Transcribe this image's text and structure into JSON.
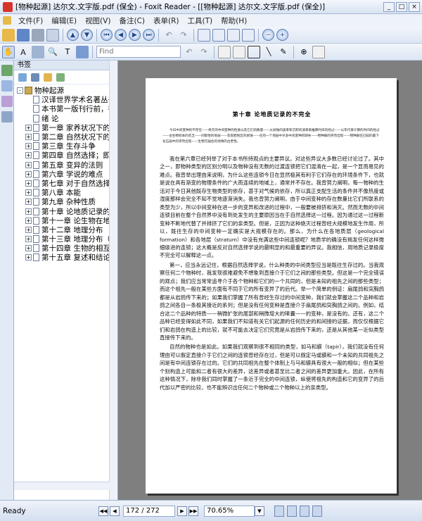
{
  "window": {
    "title": "[物种起源] 达尔文.文字版.pdf (保全) - Foxit Reader - [[物种起源] 达尔文.文字版.pdf (保全)]"
  },
  "menu": {
    "items": [
      "文件(F)",
      "编辑(E)",
      "视图(V)",
      "备注(C)",
      "表单(R)",
      "工具(T)",
      "帮助(H)"
    ]
  },
  "find": {
    "placeholder": "Find"
  },
  "bookmark_panel": {
    "title": "书签",
    "items": [
      {
        "label": "物种起源",
        "level": 0,
        "expander": "-"
      },
      {
        "label": "汉译世界学术名著丛书",
        "level": 1,
        "expander": ""
      },
      {
        "label": "本书第一版刊行前，有关",
        "level": 1,
        "expander": ""
      },
      {
        "label": "绪 论",
        "level": 1,
        "expander": ""
      },
      {
        "label": "第一章 家养状况下的变异",
        "level": 1,
        "expander": "+"
      },
      {
        "label": "第二章 自然状况下的变异",
        "level": 1,
        "expander": "+"
      },
      {
        "label": "第三章 生存斗争",
        "level": 1,
        "expander": "+"
      },
      {
        "label": "第四章 自然选择；即最适",
        "level": 1,
        "expander": "+"
      },
      {
        "label": "第五章 变异的法则",
        "level": 1,
        "expander": "+"
      },
      {
        "label": "第六章 学说的难点",
        "level": 1,
        "expander": "+"
      },
      {
        "label": "第七章 对于自然选择学说",
        "level": 1,
        "expander": "+"
      },
      {
        "label": "第八章 本能",
        "level": 1,
        "expander": "+"
      },
      {
        "label": "第九章 杂种性质",
        "level": 1,
        "expander": "+"
      },
      {
        "label": "第十章 论地质记录的不完",
        "level": 1,
        "expander": "+"
      },
      {
        "label": "第十一章 论生物在地质",
        "level": 1,
        "expander": "+"
      },
      {
        "label": "第十二章 地理分布",
        "level": 1,
        "expander": "+"
      },
      {
        "label": "第十三章 地理分布（续）",
        "level": 1,
        "expander": "+"
      },
      {
        "label": "第十四章 生物的相互亲缘",
        "level": 1,
        "expander": "+"
      },
      {
        "label": "第十五章 复述和结论",
        "level": 1,
        "expander": "+"
      }
    ]
  },
  "document": {
    "chapter_title": "第十章 论地质记录的不完全",
    "epigraph": "今日中间变种的不存在——绝灭的中间变种的性质以及它们的数量——从剥蚀的速率和沉积的速率来推算时间的经过——以年代来计算的时间的经过——古生物标本的贫乏——间歇性的地层——花岗岩地区的剥蚀——任何一个地层中许多中间变种的缺失——物种群的突然出现——物种群在已知的最下化石层中的突然出现——生物可居住的地球的古老性。",
    "paragraphs": [
      "我在第六章已经列举了对于本书所持观点的主要异议。对这些异议大多数已经讨论过了。其中之一，即物种类型的区别分明以及物种没有无数的过渡连锁把它们混淆在一起，是一个显而易见的难点。我曾举出理由来说明，为什么这些连锁今日在显然极其有利于它们存在的环境条件下，也就是说在具有渐变的物理条件的广大而连续的地域上，通常并不存在。我曾努力阐明，每一物种的生活对于今日其他既存生物类型的依存，甚于对气候的依存，所以真正支配生活的条件并不像热度或湿度那样会完全不知不觉地逐渐消失。我也曾努力阐明，由于中间变种的存在数量比它们所联系的类型为少，所以中间变种在进一步的变异和改进的过程中，一般要被排挤和消灭。然而无数的中间连锁目前在整个自然界中没有到处发生的主要原因当在于自然选择这一过程。因为通过这一过程新变种不断地代替了并排挤了它们的亲类型。但是，正因为这种绝灭过程曾经大规模地发生作用，所以，既往生存的中间变种一定确实是大规模存在的。那么，为什么在各地质层（geological formation）和各地层（stratum）中没有充满这些中间连锁呢？地质学的确没有揭发任何这样微细级进的连锁；这大概是反对自然选择学说的最明显的和最重要的异议。我相信，用地质记录极度不完全可以解释这一点。",
      "第一，应当永远记住，根据自然选择学说，什么种类的中间类型应当是既往生存过的。当我观察任何二个物种时，我发现很难避免不想象到直接介于它们之间的那些类型。但这是一个完全错误的观点；我们应当常常追寻介于各个物种和它们的一个共同的，但是未知的祖先之间的那些类型；而这个祖先一般在某些方面有不同于它的所有变异了的后代。举一个简单的例证：扇尾鸽和突胸鸽都是从岩鸽传下来的；如果我们掌握了所有曾经生存过的中间变种，我们就会掌握这二个品种和岩鸽之间各自一条极其接近的系列；但是没有任何变种是直接介于扇尾鸽和突胸鸽之间的。例如，结合这二个品种的特质——稍微扩张的尾部和稍微增大的嗉囊——的变种，是没有的。还有，这二个品种已经变得如此不同，如果我们不知道有关它们起源的任何历史的和间接的证据，而仅仅根据它们和岩鸽在构造上的比较，就不可能去决定它们究竟是从岩鸽传下来的，还是从其他某一近似类型直接传下来的。",
      "自然的物种也是如此。如果我们观察到很不相同的类型，如马和貘（tapir），我们就没有任何理由可以假定直接介于它们之间的连锁曾经存在过，但是可以假定马或貘和一个未知的共同祖先之间是有中间连锁存在过的。它们的共同祖先在整个体制上与马和貘具有很大一般的相似；但在某些个别构造上可能和二者有很大的差异，这差异或者甚至比二者之间的差异更加重大。因此，在所有这种情况下，除非我们同时掌握了一条近于完全的中间连锁，纵使将祖先的构造和它的变异了的后代加以严密的比较，也不能辨识出任何二个物种或二个物种以上的亲类型。"
    ]
  },
  "status": {
    "ready": "Ready",
    "page": "172 / 272",
    "zoom": "70.65%"
  }
}
